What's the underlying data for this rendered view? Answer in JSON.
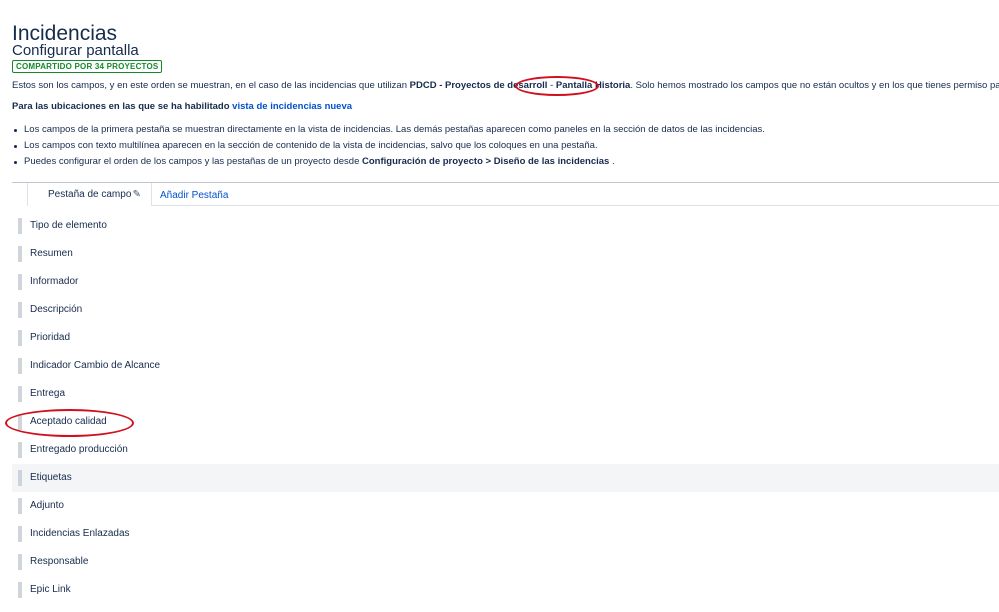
{
  "header": {
    "title": "Incidencias",
    "section": "Configurar pantalla",
    "shared_badge": "COMPARTIDO POR 34 PROYECTOS"
  },
  "description": {
    "prefix": "Estos son los campos, y en este orden se muestran, en el caso de las incidencias que utilizan ",
    "project": "PDCD - Proyectos de desarroll",
    "screen": "Pantalla Historia",
    "suffix": ". Solo hemos mostrado los campos que no están ocultos y en los que tienes permiso para editar."
  },
  "new_view": {
    "text": "Para las ubicaciones en las que se ha habilitado ",
    "link": "vista de incidencias nueva"
  },
  "bullets": {
    "b1": "Los campos de la primera pestaña se muestran directamente en la vista de incidencias. Las demás pestañas aparecen como paneles en la sección de datos de las incidencias.",
    "b2": "Los campos con texto multilínea aparecen en la sección de contenido de la vista de incidencias, salvo que los coloques en una pestaña.",
    "b3_prefix": "Puedes configurar el orden de los campos y las pestañas de un proyecto desde ",
    "b3_bold": "Configuración de proyecto > Diseño de las incidencias",
    "b3_suffix": " ."
  },
  "tabs": {
    "active": "Pestaña de campo",
    "add": "Añadir Pestaña"
  },
  "fields": [
    "Tipo de elemento",
    "Resumen",
    "Informador",
    "Descripción",
    "Prioridad",
    "Indicador Cambio de Alcance",
    "Entrega",
    "Aceptado calidad",
    "Entregado producción",
    "Etiquetas",
    "Adjunto",
    "Incidencias Enlazadas",
    "Responsable",
    "Epic Link"
  ],
  "colors": {
    "link": "#0052cc",
    "badge": "#14892c",
    "annotation": "#d0101e"
  }
}
